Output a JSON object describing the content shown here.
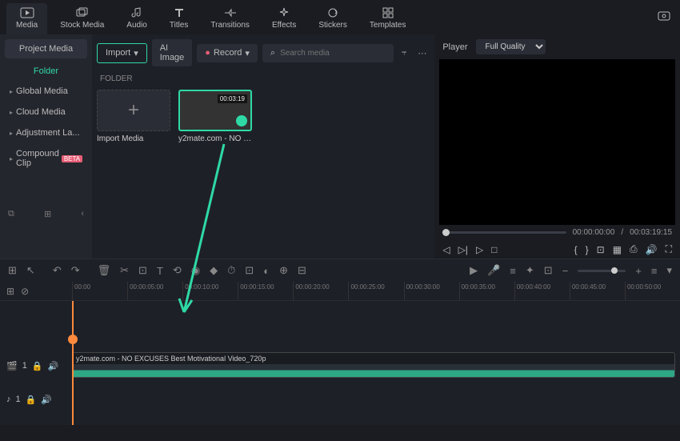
{
  "tabs": [
    {
      "label": "Media",
      "name": "tab-media"
    },
    {
      "label": "Stock Media",
      "name": "tab-stock"
    },
    {
      "label": "Audio",
      "name": "tab-audio"
    },
    {
      "label": "Titles",
      "name": "tab-titles"
    },
    {
      "label": "Transitions",
      "name": "tab-transitions"
    },
    {
      "label": "Effects",
      "name": "tab-effects"
    },
    {
      "label": "Stickers",
      "name": "tab-stickers"
    },
    {
      "label": "Templates",
      "name": "tab-templates"
    }
  ],
  "sidebar": {
    "header": "Project Media",
    "sub": "Folder",
    "items": [
      {
        "label": "Global Media"
      },
      {
        "label": "Cloud Media"
      },
      {
        "label": "Adjustment La..."
      },
      {
        "label": "Compound Clip",
        "badge": "BETA"
      }
    ]
  },
  "media": {
    "import": "Import",
    "ai": "AI Image",
    "record": "Record",
    "search_ph": "Search media",
    "folder": "FOLDER",
    "import_th": "Import Media",
    "clip": {
      "dur": "00:03:19",
      "name": "y2mate.com - NO EXC..."
    }
  },
  "preview": {
    "player": "Player",
    "quality": "Full Quality",
    "current": "00:00:00:00",
    "sep": "/",
    "total": "00:03:19:15"
  },
  "ruler": [
    "00:00",
    "00:00:05:00",
    "00:00:10:00",
    "00:00:15:00",
    "00:00:20:00",
    "00:00:25:00",
    "00:00:30:00",
    "00:00:35:00",
    "00:00:40:00",
    "00:00:45:00",
    "00:00:50:00"
  ],
  "clip_label": "y2mate.com - NO EXCUSES  Best Motivational Video_720p",
  "track": {
    "v": "1",
    "a": "1"
  }
}
